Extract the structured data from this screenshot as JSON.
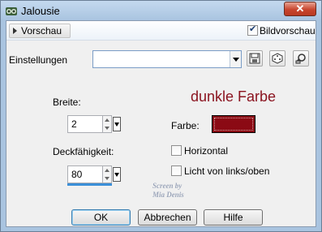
{
  "window": {
    "title": "Jalousie",
    "close_glyph": "✕"
  },
  "preview": {
    "label": "Vorschau",
    "bildvorschau_label": "Bildvorschau",
    "bildvorschau_checked": true
  },
  "settings": {
    "label": "Einstellungen",
    "value": ""
  },
  "breite": {
    "label": "Breite:",
    "value": "2"
  },
  "deckfaehigkeit": {
    "label": "Deckfähigkeit:",
    "value": "80"
  },
  "annotation": {
    "text": "dunkle Farbe",
    "color": "#8b1420"
  },
  "farbe": {
    "label": "Farbe:",
    "color": "#8b0a14"
  },
  "horizontal": {
    "label": "Horizontal",
    "checked": false
  },
  "licht": {
    "label": "Licht von links/oben",
    "checked": false
  },
  "watermark": {
    "line1": "Screen by",
    "line2": "Mia Denis"
  },
  "buttons": {
    "ok": "OK",
    "cancel": "Abbrechen",
    "help": "Hilfe"
  },
  "icons": {
    "app": "jalousie-app-icon",
    "save": "save-icon",
    "randomize": "dice-icon",
    "reset": "reset-icon"
  }
}
